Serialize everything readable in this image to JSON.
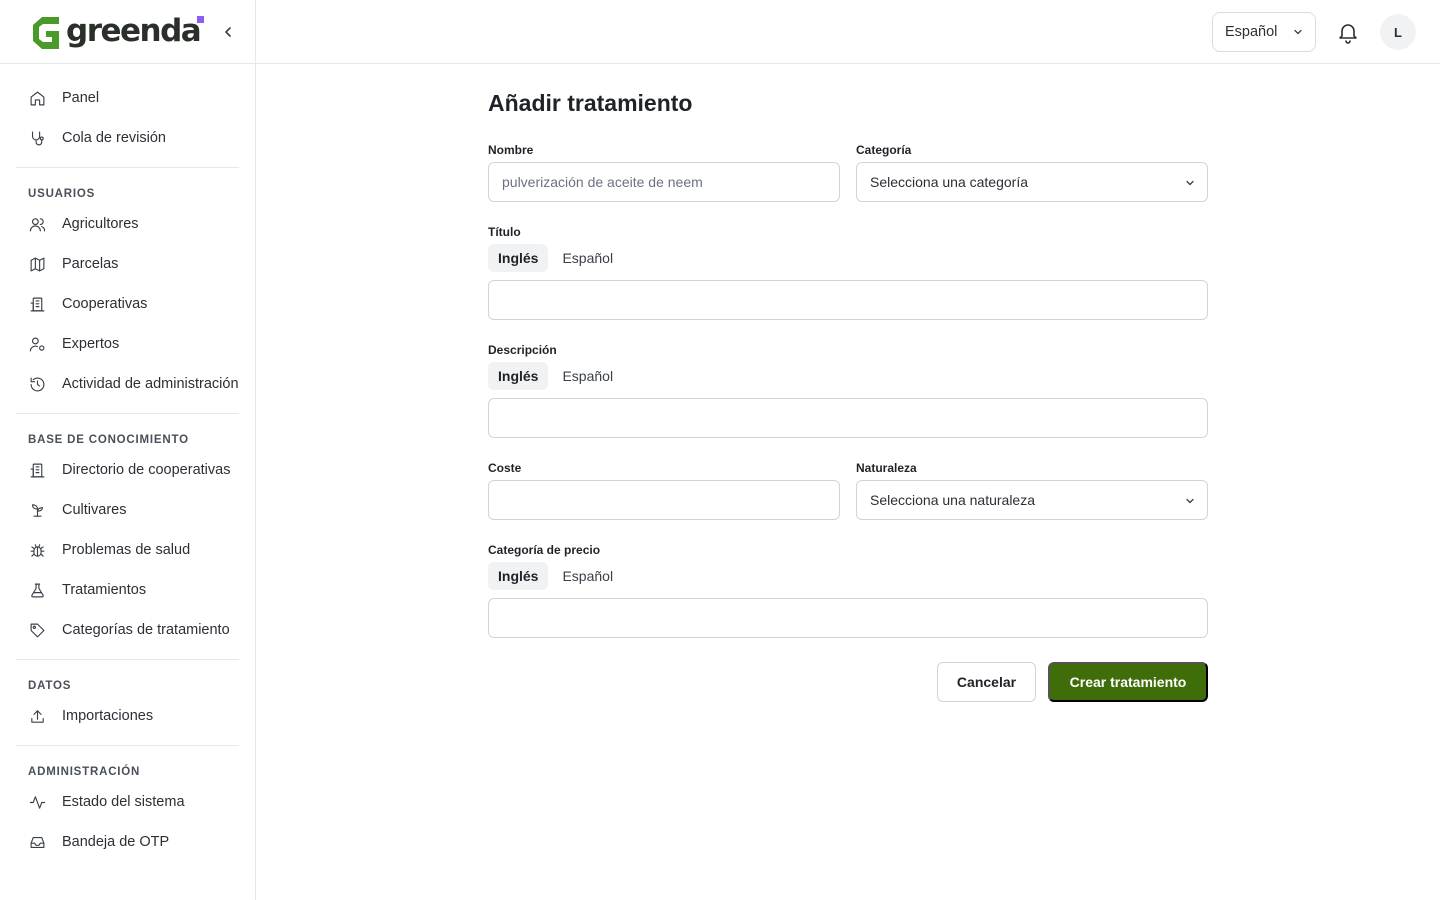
{
  "brand": {
    "name": "greenda",
    "accent": "#8b5cf6",
    "logo_green": "#4a9a2a",
    "primary_button": "#3f6d0a"
  },
  "sidebar": {
    "collapse_icon": "chevron-left-icon",
    "top_items": [
      {
        "label": "Panel",
        "icon": "home-icon"
      },
      {
        "label": "Cola de revisión",
        "icon": "stethoscope-icon"
      }
    ],
    "groups": [
      {
        "title": "USUARIOS",
        "items": [
          {
            "label": "Agricultores",
            "icon": "users-icon"
          },
          {
            "label": "Parcelas",
            "icon": "map-icon"
          },
          {
            "label": "Cooperativas",
            "icon": "building-icon"
          },
          {
            "label": "Expertos",
            "icon": "user-cog-icon"
          },
          {
            "label": "Actividad de administración",
            "icon": "history-icon"
          }
        ]
      },
      {
        "title": "BASE DE CONOCIMIENTO",
        "items": [
          {
            "label": "Directorio de cooperativas",
            "icon": "building-icon"
          },
          {
            "label": "Cultivares",
            "icon": "sprout-icon"
          },
          {
            "label": "Problemas de salud",
            "icon": "bug-icon"
          },
          {
            "label": "Tratamientos",
            "icon": "flask-icon"
          },
          {
            "label": "Categorías de tratamiento",
            "icon": "tag-icon"
          }
        ]
      },
      {
        "title": "DATOS",
        "items": [
          {
            "label": "Importaciones",
            "icon": "upload-icon"
          }
        ]
      },
      {
        "title": "ADMINISTRACIÓN",
        "items": [
          {
            "label": "Estado del sistema",
            "icon": "activity-icon"
          },
          {
            "label": "Bandeja de OTP",
            "icon": "inbox-icon"
          }
        ]
      }
    ]
  },
  "topbar": {
    "language": "Español",
    "notification_icon": "bell-icon",
    "avatar_initial": "L"
  },
  "form": {
    "title": "Añadir tratamiento",
    "name": {
      "label": "Nombre",
      "placeholder": "pulverización de aceite de neem",
      "value": ""
    },
    "category": {
      "label": "Categoría",
      "selected": "Selecciona una categoría"
    },
    "title_field": {
      "label": "Título",
      "tabs": [
        "Inglés",
        "Español"
      ],
      "active_tab": "Inglés",
      "value": ""
    },
    "description": {
      "label": "Descripción",
      "tabs": [
        "Inglés",
        "Español"
      ],
      "active_tab": "Inglés",
      "value": ""
    },
    "cost": {
      "label": "Coste",
      "value": ""
    },
    "nature": {
      "label": "Naturaleza",
      "selected": "Selecciona una naturaleza"
    },
    "price_category": {
      "label": "Categoría de precio",
      "tabs": [
        "Inglés",
        "Español"
      ],
      "active_tab": "Inglés",
      "value": ""
    },
    "cancel_label": "Cancelar",
    "submit_label": "Crear tratamiento"
  }
}
